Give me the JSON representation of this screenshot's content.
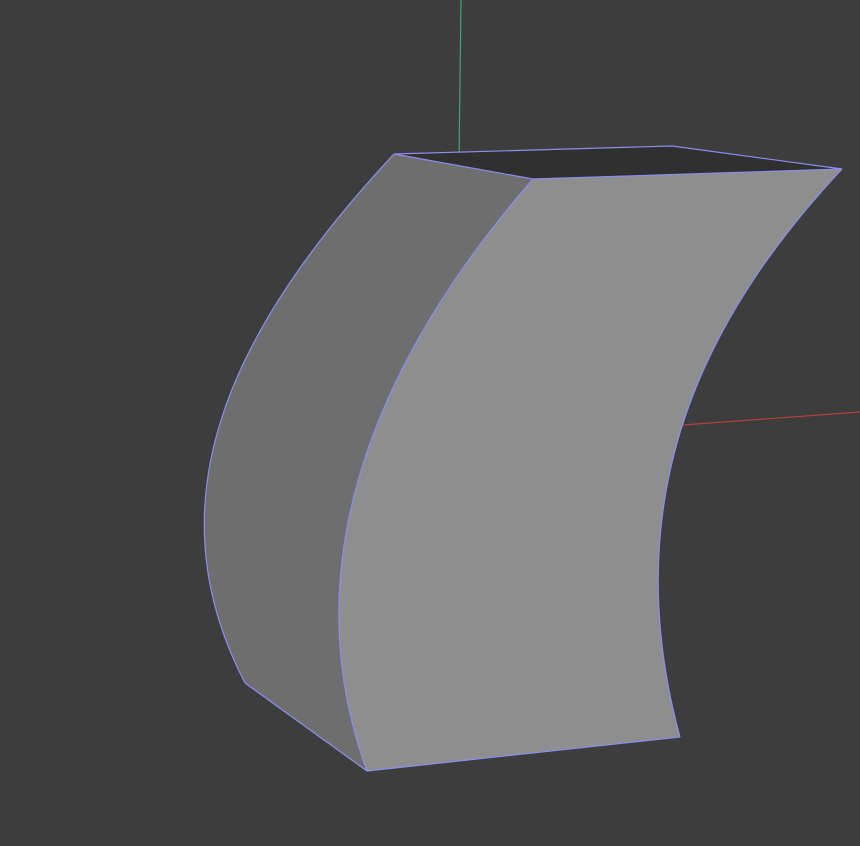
{
  "viewport": {
    "background": "#3d3d3d",
    "object": {
      "shape": "curved-extruded-block",
      "face_colors": {
        "front": "#8e8e8e",
        "side": "#6e6e6e",
        "top": "#303030"
      },
      "selected": true,
      "selection_edge_color": "#8f8cf0"
    },
    "axes": {
      "x_axis_color": "#b0413e",
      "y_axis_color": "#3aa86a"
    }
  }
}
